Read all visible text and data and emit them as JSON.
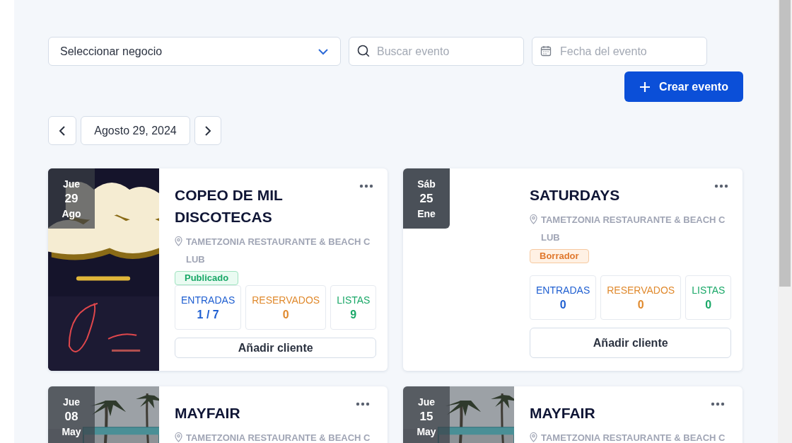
{
  "filters": {
    "business_select": {
      "value": "Seleccionar negocio"
    },
    "search": {
      "placeholder": "Buscar evento"
    },
    "date": {
      "placeholder": "Fecha del evento"
    }
  },
  "create_button": {
    "label": "Crear evento"
  },
  "date_nav": {
    "label": "Agosto 29, 2024"
  },
  "events": [
    {
      "weekday": "Jue",
      "day": "29",
      "month": "Ago",
      "kind": "poster",
      "title": "COPEO DE MIL DISCOTECAS",
      "location": "TAMETZONIA RESTAURANTE & BEACH CLUB",
      "status": {
        "label": "Publicado",
        "kind": "published"
      },
      "stats": [
        {
          "kind": "tickets",
          "label": "ENTRADAS",
          "value": "1 / 7"
        },
        {
          "kind": "reserved",
          "label": "RESERVADOS",
          "value": "0"
        },
        {
          "kind": "lists",
          "label": "LISTAS",
          "value": "9"
        }
      ],
      "action": "Añadir cliente"
    },
    {
      "weekday": "Sáb",
      "day": "25",
      "month": "Ene",
      "kind": "plain",
      "title": "SATURDAYS",
      "location": "TAMETZONIA RESTAURANTE & BEACH CLUB",
      "status": {
        "label": "Borrador",
        "kind": "draft"
      },
      "stats": [
        {
          "kind": "tickets",
          "label": "ENTRADAS",
          "value": "0"
        },
        {
          "kind": "reserved",
          "label": "RESERVADOS",
          "value": "0"
        },
        {
          "kind": "lists",
          "label": "LISTAS",
          "value": "0"
        }
      ],
      "action": "Añadir cliente"
    },
    {
      "weekday": "Jue",
      "day": "08",
      "month": "May",
      "title": "MAYFAIR",
      "location": "TAMETZONIA RESTAURANTE & BEACH C"
    },
    {
      "weekday": "Jue",
      "day": "15",
      "month": "May",
      "title": "MAYFAIR",
      "location": "TAMETZONIA RESTAURANTE & BEACH C"
    }
  ]
}
